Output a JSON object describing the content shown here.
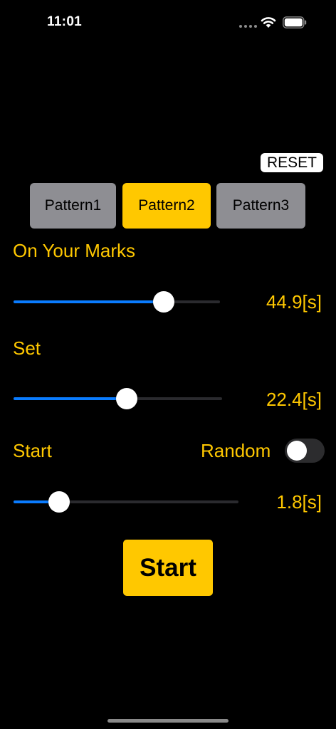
{
  "status_bar": {
    "time": "11:01",
    "icons": [
      "signal-dots-icon",
      "wifi-icon",
      "battery-icon"
    ]
  },
  "reset_label": "RESET",
  "patterns": {
    "items": [
      "Pattern1",
      "Pattern2",
      "Pattern3"
    ],
    "selected": "Pattern2"
  },
  "on_your_marks": {
    "label": "On Your Marks",
    "value": "44.9[s]",
    "slider_fraction": 0.727
  },
  "set": {
    "label": "Set",
    "value": "22.4[s]",
    "slider_fraction": 0.543
  },
  "start_section": {
    "label": "Start",
    "random_label": "Random",
    "random_on": false,
    "value": "1.8[s]",
    "slider_fraction": 0.203
  },
  "start_button_label": "Start",
  "colors": {
    "accent": "#ffc800",
    "slider_blue": "#0a7cff",
    "segment_inactive": "#8e8e93",
    "background": "#000000"
  }
}
